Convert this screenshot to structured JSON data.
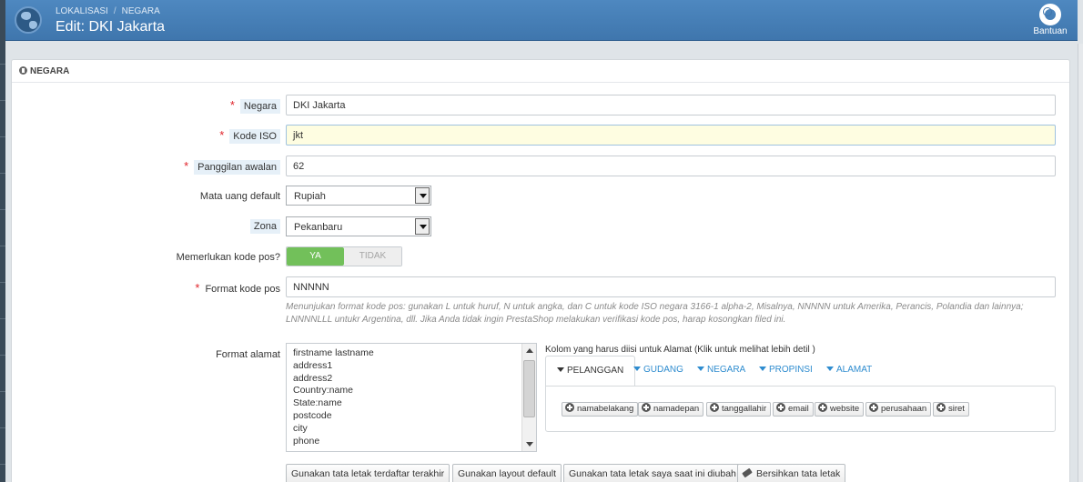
{
  "header": {
    "breadcrumb": [
      "LOKALISASI",
      "NEGARA"
    ],
    "breadcrumb_sep": "/",
    "title": "Edit: DKI Jakarta",
    "help_label": "Bantuan"
  },
  "panel": {
    "heading": "NEGARA"
  },
  "form": {
    "country": {
      "label": "Negara",
      "required": "*",
      "value": "DKI Jakarta"
    },
    "iso": {
      "label": "Kode ISO",
      "required": "*",
      "value": "jkt"
    },
    "call_prefix": {
      "label": "Panggilan awalan",
      "required": "*",
      "value": "62"
    },
    "currency": {
      "label": "Mata uang default",
      "value": "Rupiah"
    },
    "zone": {
      "label": "Zona",
      "value": "Pekanbaru"
    },
    "needs_zip": {
      "label": "Memerlukan kode pos?",
      "yes": "YA",
      "no": "TIDAK",
      "selected": "YA"
    },
    "zip_format": {
      "label": "Format kode pos",
      "required": "*",
      "value": "NNNNN",
      "help_line1": "Menunjukan format kode pos: gunakan L untuk huruf, N untuk angka, dan C untuk kode ISO negara 3166-1 alpha-2, Misalnya, NNNNN untuk Amerika, Perancis, Polandia dan lainnya;",
      "help_line2": "LNNNNLLL untukr Argentina, dll. Jika Anda tidak ingin PrestaShop melakukan verifikasi kode pos, harap kosongkan filed ini."
    },
    "address_format": {
      "label": "Format alamat",
      "lines": [
        "firstname lastname",
        "address1",
        "address2",
        "Country:name",
        "State:name",
        "postcode",
        "city",
        "phone"
      ]
    }
  },
  "address_fields": {
    "heading": "Kolom yang harus diisi untuk Alamat (Klik untuk melihat lebih detil )",
    "tabs": [
      "PELANGGAN",
      "GUDANG",
      "NEGARA",
      "PROPINSI",
      "ALAMAT"
    ],
    "active_tab": "PELANGGAN",
    "buttons": [
      "namabelakang",
      "namadepan",
      "tanggallahir",
      "email",
      "website",
      "perusahaan",
      "siret"
    ]
  },
  "layout_buttons": {
    "last_registered": "Gunakan tata letak terdaftar terakhir",
    "default": "Gunakan layout default",
    "current": "Gunakan tata letak saya saat ini diubah",
    "clear": "Bersihkan tata letak"
  },
  "icons": {
    "logo": "globe-icon",
    "help": "lifebuoy-icon",
    "panel": "info-circle-icon",
    "add": "plus-circle-icon",
    "clear": "eraser-icon"
  },
  "colors": {
    "header": "#4580b8",
    "required": "#e0242b",
    "toggle_on": "#72c05a",
    "link": "#2e8ccf",
    "highlight_input": "#fefde1"
  }
}
